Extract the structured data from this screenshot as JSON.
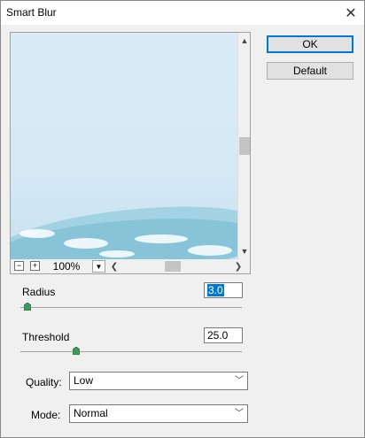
{
  "window": {
    "title": "Smart Blur"
  },
  "preview": {
    "zoom": "100%"
  },
  "buttons": {
    "ok": "OK",
    "default": "Default"
  },
  "radius": {
    "label": "Radius",
    "value": "3.0"
  },
  "threshold": {
    "label": "Threshold",
    "value": "25.0"
  },
  "quality": {
    "label": "Quality:",
    "value": "Low"
  },
  "mode": {
    "label": "Mode:",
    "value": "Normal"
  },
  "colors": {
    "accent": "#0078d7",
    "slider_thumb": "#3a9a5a"
  }
}
